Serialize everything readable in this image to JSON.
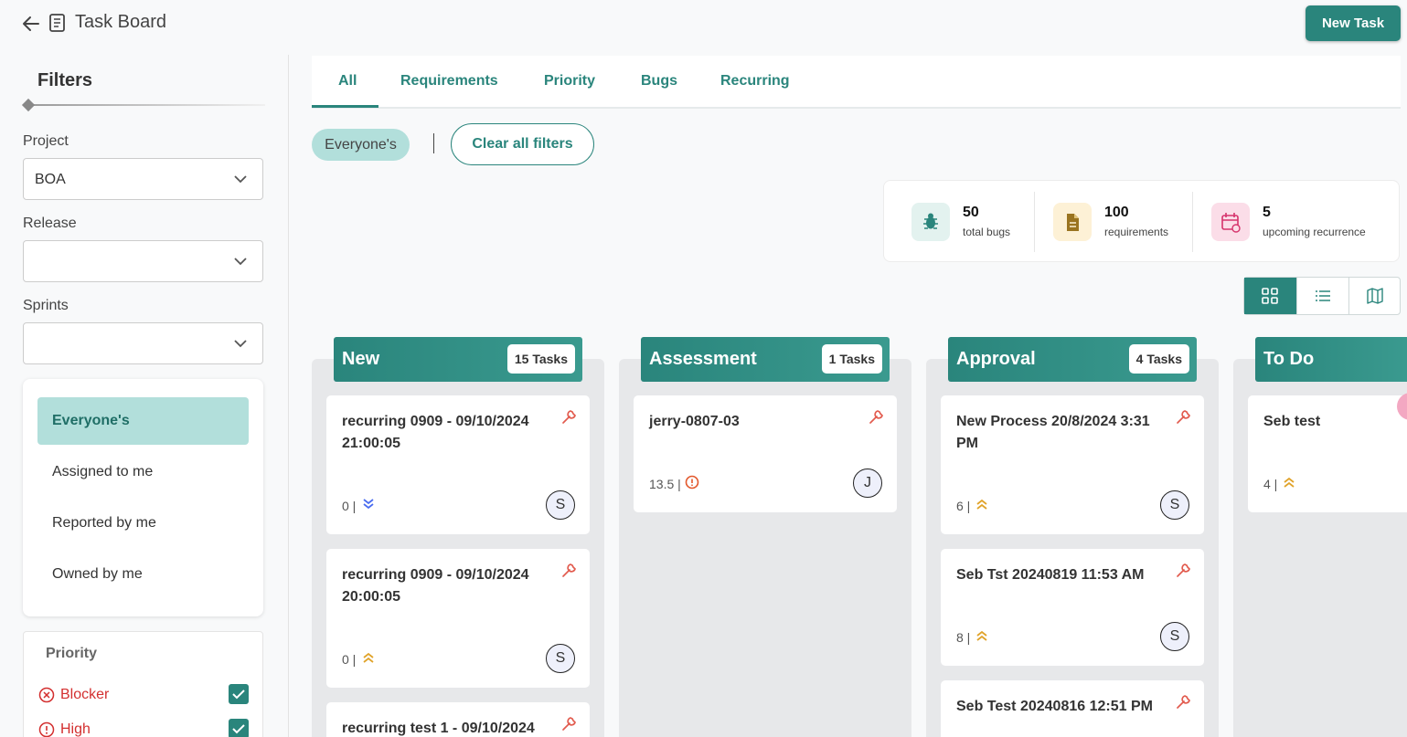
{
  "header": {
    "title": "Task Board",
    "new_task_label": "New Task"
  },
  "sidebar": {
    "filters_title": "Filters",
    "project_label": "Project",
    "project_value": "BOA",
    "release_label": "Release",
    "release_value": "",
    "sprints_label": "Sprints",
    "sprints_value": "",
    "scope_items": [
      "Everyone's",
      "Assigned to me",
      "Reported by me",
      "Owned by me"
    ],
    "priority_title": "Priority",
    "priorities": [
      {
        "label": "Blocker",
        "checked": true
      },
      {
        "label": "High",
        "checked": true
      }
    ]
  },
  "tabs": [
    "All",
    "Requirements",
    "Priority",
    "Bugs",
    "Recurring"
  ],
  "active_tab": "All",
  "filter_chip": "Everyone's",
  "clear_filters_label": "Clear all filters",
  "stats": [
    {
      "value": "50",
      "label": "total bugs",
      "icon": "bug-icon",
      "color": "#e3f2ef"
    },
    {
      "value": "100",
      "label": "requirements",
      "icon": "document-icon",
      "color": "#fdf1d6"
    },
    {
      "value": "5",
      "label": "upcoming recurrence",
      "icon": "calendar-recur-icon",
      "color": "#fbdde8"
    }
  ],
  "columns": [
    {
      "title": "New",
      "count": "15 Tasks",
      "cards": [
        {
          "title": "recurring 0909 - 09/10/2024 21:00:05",
          "points": "0",
          "priority": "low",
          "avatar": "S"
        },
        {
          "title": "recurring 0909 - 09/10/2024 20:00:05",
          "points": "0",
          "priority": "medium",
          "avatar": "S"
        },
        {
          "title": "recurring test 1 - 09/10/2024",
          "points": "",
          "priority": "",
          "avatar": ""
        }
      ]
    },
    {
      "title": "Assessment",
      "count": "1 Tasks",
      "cards": [
        {
          "title": "jerry-0807-03",
          "points": "13.5",
          "priority": "high",
          "avatar": "J"
        }
      ]
    },
    {
      "title": "Approval",
      "count": "4 Tasks",
      "cards": [
        {
          "title": "New Process 20/8/2024 3:31 PM",
          "points": "6",
          "priority": "medium",
          "avatar": "S"
        },
        {
          "title": "Seb Tst 20240819 11:53 AM",
          "points": "8",
          "priority": "medium",
          "avatar": "S"
        },
        {
          "title": "Seb Test 20240816 12:51 PM",
          "points": "",
          "priority": "",
          "avatar": ""
        }
      ]
    },
    {
      "title": "To Do",
      "count": "",
      "cards": [
        {
          "title": "Seb test",
          "points": "4",
          "priority": "medium",
          "avatar": ""
        }
      ]
    }
  ],
  "colors": {
    "accent": "#2a857c",
    "chip": "#b2dfdb",
    "danger": "#d32f2f",
    "wrench": "#e25b4e"
  }
}
